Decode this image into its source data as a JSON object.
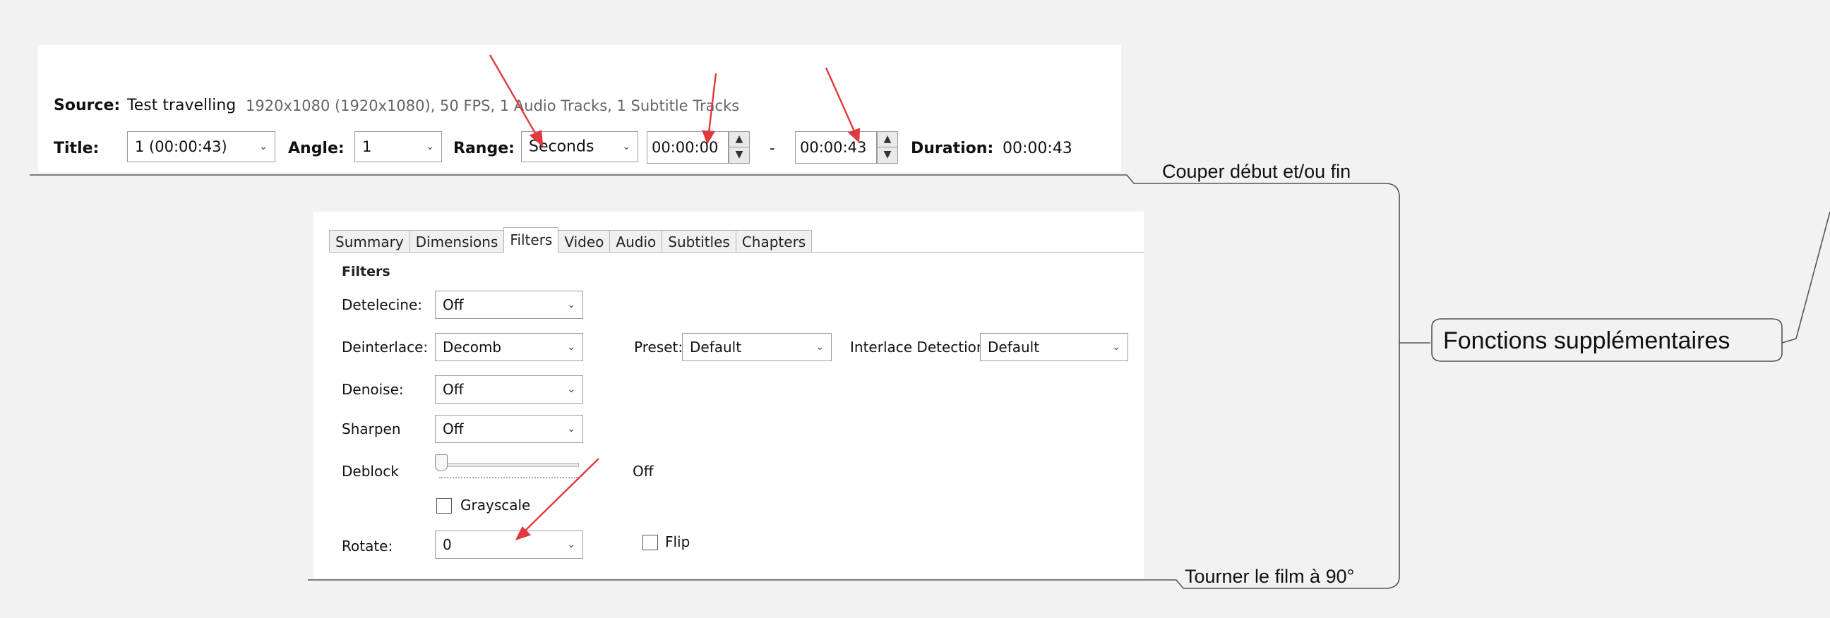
{
  "source": {
    "label": "Source:",
    "name": "Test travelling",
    "info": "1920x1080 (1920x1080), 50 FPS, 1 Audio Tracks, 1 Subtitle Tracks"
  },
  "title_row": {
    "title_label": "Title:",
    "title_value": "1 (00:00:43)",
    "angle_label": "Angle:",
    "angle_value": "1",
    "range_label": "Range:",
    "range_value": "Seconds",
    "start_time": "00:00:00",
    "separator": "-",
    "end_time": "00:00:43",
    "duration_label": "Duration:",
    "duration_value": "00:00:43"
  },
  "tabs": [
    "Summary",
    "Dimensions",
    "Filters",
    "Video",
    "Audio",
    "Subtitles",
    "Chapters"
  ],
  "filters": {
    "heading": "Filters",
    "detelecine_label": "Detelecine:",
    "detelecine_value": "Off",
    "deinterlace_label": "Deinterlace:",
    "deinterlace_value": "Decomb",
    "preset_label": "Preset:",
    "preset_value": "Default",
    "interlace_detection_label": "Interlace Detection:",
    "interlace_detection_value": "Default",
    "denoise_label": "Denoise:",
    "denoise_value": "Off",
    "sharpen_label": "Sharpen",
    "sharpen_value": "Off",
    "deblock_label": "Deblock",
    "deblock_value": "Off",
    "grayscale_label": "Grayscale",
    "rotate_label": "Rotate:",
    "rotate_value": "0",
    "flip_label": "Flip"
  },
  "mindmap": {
    "central_node": "Fonctions supplémentaires",
    "branch_trim": "Couper début et/ou fin",
    "branch_rotate": "Tourner le film à 90°"
  },
  "colors": {
    "arrow": "#e0393e",
    "connector": "#555555",
    "focus": "#1e73c8"
  },
  "icons": {
    "dropdown": "chevron-down-icon",
    "spin_up": "triangle-up",
    "spin_down": "triangle-down"
  }
}
